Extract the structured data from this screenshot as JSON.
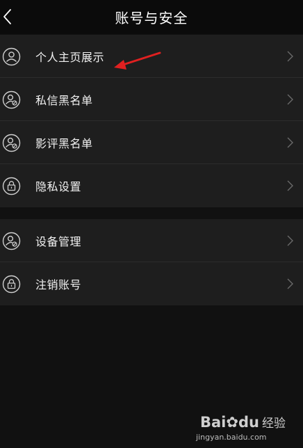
{
  "header": {
    "title": "账号与安全",
    "back_icon": "chevron-left-icon"
  },
  "group1": {
    "items": [
      {
        "label": "个人主页展示",
        "icon": "user-circle-icon"
      },
      {
        "label": "私信黑名单",
        "icon": "user-blocked-icon"
      },
      {
        "label": "影评黑名单",
        "icon": "user-blocked-icon"
      },
      {
        "label": "隐私设置",
        "icon": "lock-icon"
      }
    ]
  },
  "group2": {
    "items": [
      {
        "label": "设备管理",
        "icon": "user-blocked-icon"
      },
      {
        "label": "注销账号",
        "icon": "lock-icon"
      }
    ]
  },
  "annotation": {
    "arrow_color": "#e02020"
  },
  "watermark": {
    "logo": "Bai",
    "logo_suffix": "du",
    "logo_text": "经验",
    "url": "jingyan.baidu.com"
  },
  "colors": {
    "background": "#111111",
    "header": "#0b0b0b",
    "row_background": "#1e1e1e",
    "divider": "#2c2c2c",
    "text": "#f2f2f2",
    "icon": "#cfcfcf"
  }
}
